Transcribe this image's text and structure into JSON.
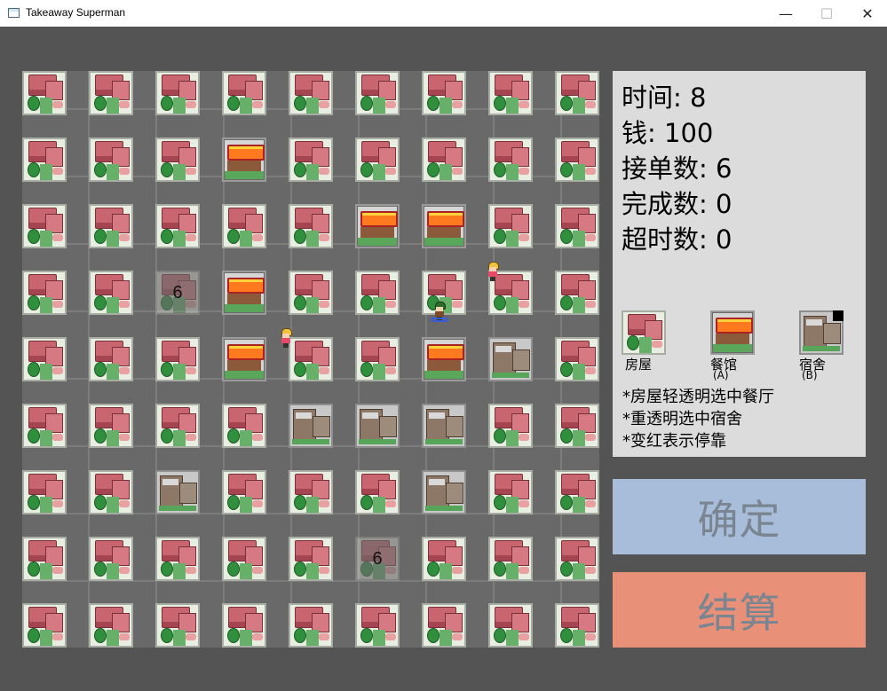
{
  "window": {
    "title": "Takeaway Superman",
    "minimize_glyph": "—",
    "maximize_glyph": "☐",
    "close_glyph": "✕"
  },
  "grid": {
    "rows": [
      "HHHHHHHHH",
      "HHHRHHHHH",
      "HHHHHRRHH",
      "HHHRHHHHH",
      "HHHRHHRDH",
      "HHHHDDDHH",
      "HHDHHHDHH",
      "HHHHHHHHH",
      "HHHHHHHHH"
    ],
    "orders": [
      {
        "row": 3,
        "col": 2,
        "count": "6"
      },
      {
        "row": 7,
        "col": 5,
        "count": "6"
      }
    ],
    "characters": [
      {
        "kind": "walker",
        "row": 3,
        "col": 6.9
      },
      {
        "kind": "walker",
        "row": 4,
        "col": 3.8
      },
      {
        "kind": "rider",
        "row": 3.6,
        "col": 6.1
      }
    ]
  },
  "stats": {
    "time": "时间: 8",
    "money": "钱: 100",
    "accepted": "接单数: 6",
    "completed": "完成数: 0",
    "overtime": "超时数: 0"
  },
  "legend": {
    "house": {
      "label": "房屋",
      "key": ""
    },
    "restaurant": {
      "label": "餐馆",
      "key": "(A)"
    },
    "dorm": {
      "label": "宿舍",
      "key": "(B)"
    }
  },
  "tips": [
    "*房屋轻透明选中餐厅",
    "*重透明选中宿舍",
    "*变红表示停靠"
  ],
  "buttons": {
    "confirm": "确定",
    "settle": "结算"
  }
}
